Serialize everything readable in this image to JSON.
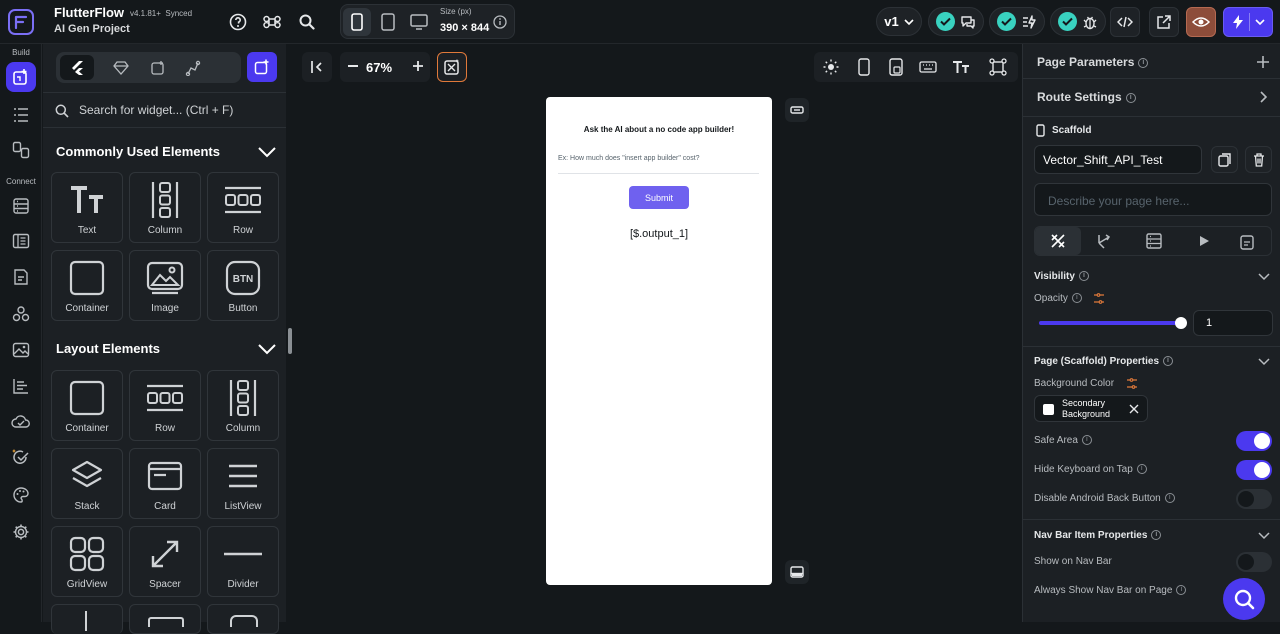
{
  "app": {
    "name": "FlutterFlow",
    "version": "v4.1.81+",
    "sync_status": "Synced",
    "project": "AI Gen Project"
  },
  "device": {
    "size_label": "Size (px)",
    "size_value": "390 × 844"
  },
  "version_selector": "v1",
  "left_rail": {
    "build_label": "Build",
    "connect_label": "Connect"
  },
  "widget_panel": {
    "search_placeholder": "Search for widget... (Ctrl + F)",
    "common_title": "Commonly Used Elements",
    "common_items": [
      "Text",
      "Column",
      "Row",
      "Container",
      "Image",
      "Button"
    ],
    "layout_title": "Layout Elements",
    "layout_items": [
      "Container",
      "Row",
      "Column",
      "Stack",
      "Card",
      "ListView",
      "GridView",
      "Spacer",
      "Divider"
    ]
  },
  "canvas": {
    "zoom": "67%",
    "phone": {
      "title": "Ask the AI about a no code app builder!",
      "input_hint": "Ex: How much does \"insert app builder\" cost?",
      "submit_label": "Submit",
      "output": "[$.output_1]"
    }
  },
  "right_panel": {
    "page_parameters": "Page Parameters",
    "route_settings": "Route Settings",
    "scaffold_label": "Scaffold",
    "page_name": "Vector_Shift_API_Test",
    "description_placeholder": "Describe your page here...",
    "visibility": "Visibility",
    "opacity_label": "Opacity",
    "opacity_value": "1",
    "opacity_level": 1.0,
    "scaffold_props": "Page (Scaffold) Properties",
    "bg_color_label": "Background Color",
    "bg_color_name_line1": "Secondary",
    "bg_color_name_line2": "Background",
    "safe_area": "Safe Area",
    "safe_area_on": true,
    "hide_keyboard": "Hide Keyboard on Tap",
    "hide_keyboard_on": true,
    "disable_back": "Disable Android Back Button",
    "disable_back_on": false,
    "nav_bar_props": "Nav Bar Item Properties",
    "show_nav": "Show on Nav Bar",
    "show_nav_on": false,
    "always_show_nav": "Always Show Nav Bar on Page"
  },
  "colors": {
    "accent": "#4b39ef",
    "submit": "#6f61ef",
    "check": "#39d2c0",
    "preview_btn": "#8d4d3a"
  }
}
